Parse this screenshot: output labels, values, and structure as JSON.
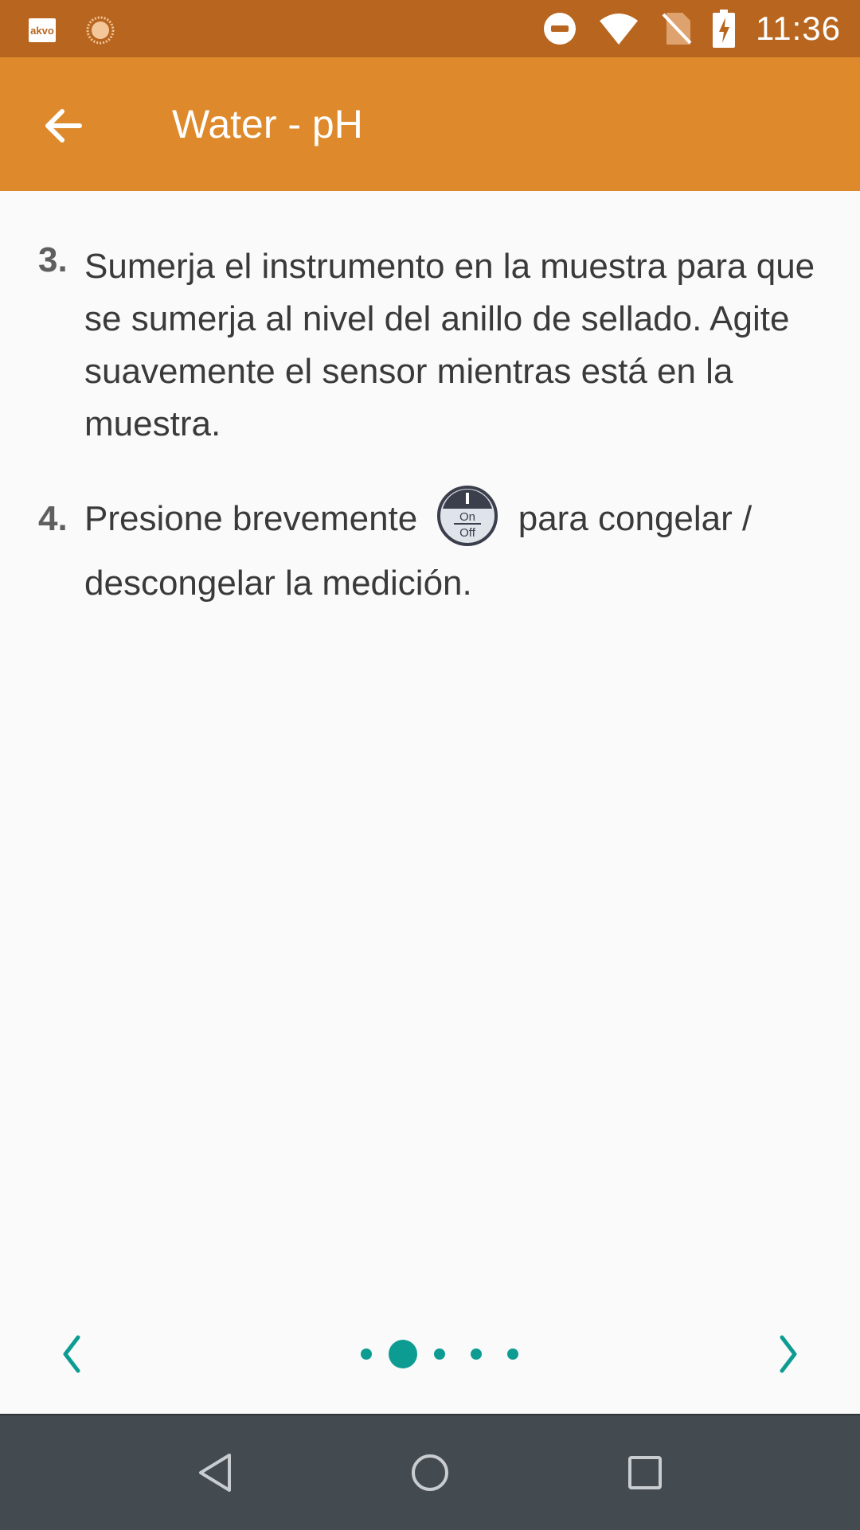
{
  "status_bar": {
    "time": "11:36",
    "akvo_label": "akvo",
    "icons": [
      "akvo-app-icon",
      "sun-loading-icon",
      "do-not-disturb-icon",
      "wifi-icon",
      "no-sim-icon",
      "battery-charging-icon"
    ]
  },
  "app_bar": {
    "title": "Water - pH",
    "back_icon": "arrow-left-icon"
  },
  "instructions": [
    {
      "number": "3.",
      "text": "Sumerja el instrumento en la muestra para que se sumerja al nivel del anillo de sellado. Agite suavemente el sensor mientras está en la muestra."
    },
    {
      "number": "4.",
      "text_before": "Presione brevemente",
      "text_after": "para congelar / descongelar la medición.",
      "button_icon": {
        "name": "on-off-button-icon",
        "label_top": "On",
        "label_bottom": "Off"
      }
    }
  ],
  "pager": {
    "prev_icon": "chevron-left-icon",
    "next_icon": "chevron-right-icon",
    "page_count": 5,
    "current_page": 2,
    "accent_color": "#0d9c92"
  },
  "colors": {
    "status_bar": "#b8661f",
    "app_bar": "#de8a2c",
    "nav_bar": "#434a50",
    "background": "#fafafa"
  },
  "system_nav": [
    "back-triangle-icon",
    "home-circle-icon",
    "recents-square-icon"
  ]
}
